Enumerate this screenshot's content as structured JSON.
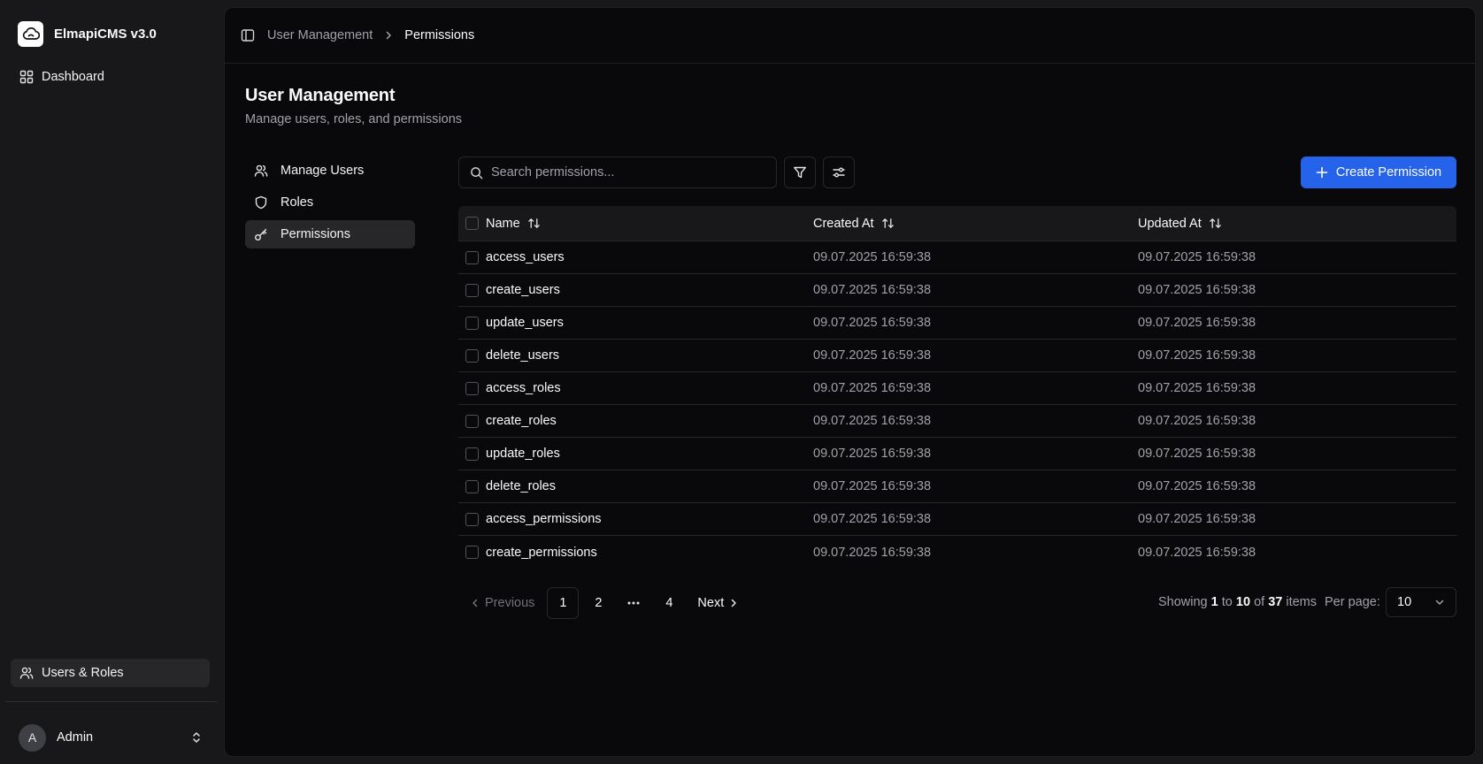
{
  "app": {
    "name": "ElmapiCMS v3.0",
    "nav": {
      "dashboard": "Dashboard",
      "users_roles": "Users & Roles"
    },
    "user": {
      "initial": "A",
      "name": "Admin"
    }
  },
  "breadcrumb": {
    "parent": "User Management",
    "current": "Permissions"
  },
  "page": {
    "title": "User Management",
    "subtitle": "Manage users, roles, and permissions"
  },
  "subnav": [
    {
      "label": "Manage Users",
      "icon": "users-icon",
      "active": false
    },
    {
      "label": "Roles",
      "icon": "shield-icon",
      "active": false
    },
    {
      "label": "Permissions",
      "icon": "key-icon",
      "active": true
    }
  ],
  "toolbar": {
    "search_placeholder": "Search permissions...",
    "search_value": "",
    "create_label": "Create Permission"
  },
  "table": {
    "columns": [
      "Name",
      "Created At",
      "Updated At"
    ],
    "rows": [
      {
        "name": "access_users",
        "created": "09.07.2025 16:59:38",
        "updated": "09.07.2025 16:59:38"
      },
      {
        "name": "create_users",
        "created": "09.07.2025 16:59:38",
        "updated": "09.07.2025 16:59:38"
      },
      {
        "name": "update_users",
        "created": "09.07.2025 16:59:38",
        "updated": "09.07.2025 16:59:38"
      },
      {
        "name": "delete_users",
        "created": "09.07.2025 16:59:38",
        "updated": "09.07.2025 16:59:38"
      },
      {
        "name": "access_roles",
        "created": "09.07.2025 16:59:38",
        "updated": "09.07.2025 16:59:38"
      },
      {
        "name": "create_roles",
        "created": "09.07.2025 16:59:38",
        "updated": "09.07.2025 16:59:38"
      },
      {
        "name": "update_roles",
        "created": "09.07.2025 16:59:38",
        "updated": "09.07.2025 16:59:38"
      },
      {
        "name": "delete_roles",
        "created": "09.07.2025 16:59:38",
        "updated": "09.07.2025 16:59:38"
      },
      {
        "name": "access_permissions",
        "created": "09.07.2025 16:59:38",
        "updated": "09.07.2025 16:59:38"
      },
      {
        "name": "create_permissions",
        "created": "09.07.2025 16:59:38",
        "updated": "09.07.2025 16:59:38"
      }
    ]
  },
  "pagination": {
    "previous": "Previous",
    "next": "Next",
    "pages": [
      "1",
      "2",
      "4"
    ],
    "current": "1",
    "ellipsis": "…",
    "showing_prefix": "Showing",
    "from": "1",
    "to_word": "to",
    "to": "10",
    "of_word": "of",
    "total": "37",
    "items_word": "items",
    "per_page_label": "Per page:",
    "per_page_value": "10"
  },
  "colors": {
    "accent": "#2563eb",
    "background": "#18181b",
    "panel": "#09090b",
    "border": "#27272a",
    "muted_text": "#a1a1aa"
  }
}
